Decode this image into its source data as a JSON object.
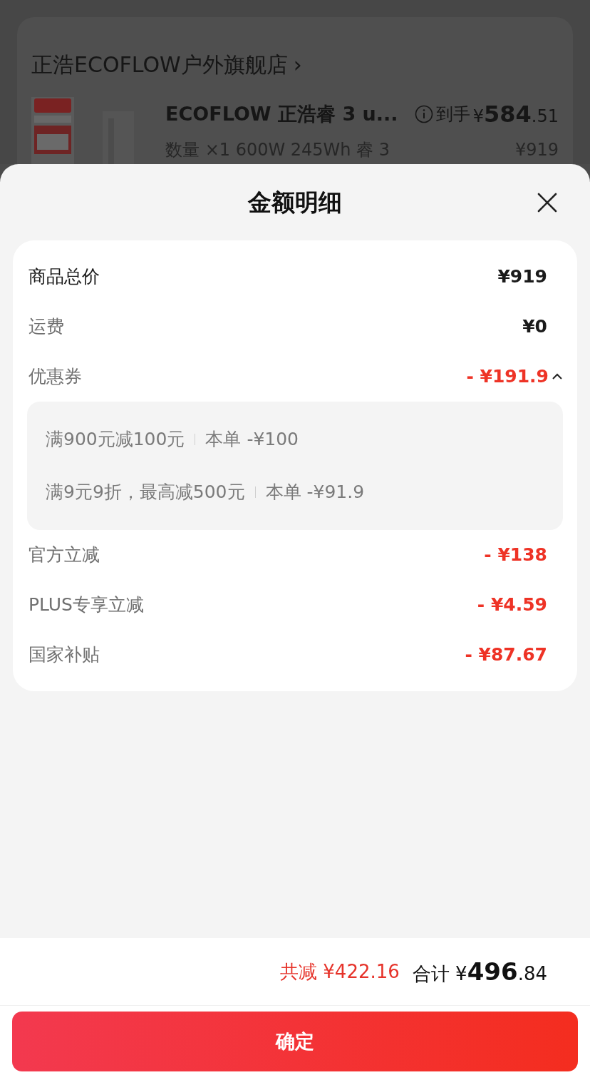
{
  "background_page": {
    "store": {
      "name": "正浩ECOFLOW户外旗舰店",
      "chevron": "›"
    },
    "product": {
      "title": "ECOFLOW 正浩睿 3 u...",
      "spec": "数量 ×1 600W 245Wh 睿 3",
      "price_label": "到手",
      "currency": "¥",
      "price_integer": "584",
      "price_decimal": ".51",
      "original_price": "¥919"
    }
  },
  "sheet": {
    "title": "金额明细",
    "rows": [
      {
        "kind": "total",
        "label": "商品总价",
        "value": "¥919"
      },
      {
        "kind": "plain",
        "label": "运费",
        "value": "¥0"
      },
      {
        "kind": "discount",
        "label": "优惠券",
        "value": "- ¥191.9",
        "expanded": true,
        "details": [
          {
            "condition": "满900元减100元",
            "amount": "本单 -¥100"
          },
          {
            "condition": "满9元9折，最高减500元",
            "amount": "本单 -¥91.9"
          }
        ]
      },
      {
        "kind": "discount",
        "label": "官方立减",
        "value": "- ¥138"
      },
      {
        "kind": "discount",
        "label": "PLUS专享立减",
        "value": "- ¥4.59"
      },
      {
        "kind": "discount",
        "label": "国家补贴",
        "value": "- ¥87.67"
      }
    ],
    "summary": {
      "discount_label": "共减",
      "discount_value": "¥422.16",
      "total_label": "合计",
      "currency": "¥",
      "total_integer": "496",
      "total_decimal": ".84"
    },
    "confirm_button": "确定"
  }
}
